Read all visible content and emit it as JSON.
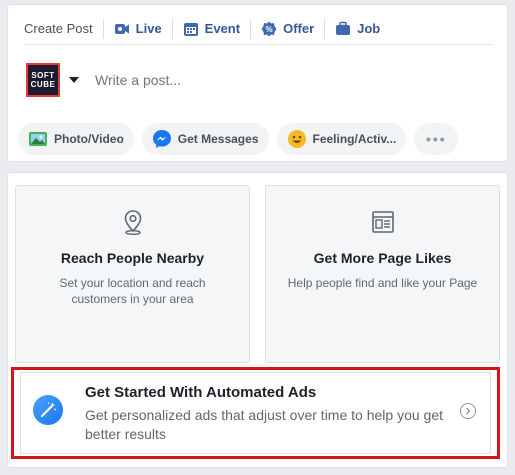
{
  "composer": {
    "tabs": [
      {
        "label": "Create Post",
        "icon": "none"
      },
      {
        "label": "Live",
        "icon": "live-video-icon"
      },
      {
        "label": "Event",
        "icon": "calendar-icon"
      },
      {
        "label": "Offer",
        "icon": "offer-tag-icon"
      },
      {
        "label": "Job",
        "icon": "briefcase-icon"
      }
    ],
    "avatar_text_line1": "SOFT",
    "avatar_text_line2": "CUBE",
    "write_placeholder": "Write a post...",
    "chips": [
      {
        "label": "Photo/Video",
        "icon": "photo-icon"
      },
      {
        "label": "Get Messages",
        "icon": "messenger-icon"
      },
      {
        "label": "Feeling/Activ...",
        "icon": "smiley-icon"
      }
    ],
    "more_label": "•••"
  },
  "promote": {
    "reach": {
      "title": "Reach People Nearby",
      "subtitle": "Set your location and reach customers in your area",
      "icon": "location-pin-icon"
    },
    "likes": {
      "title": "Get More Page Likes",
      "subtitle": "Help people find and like your Page",
      "icon": "page-icon"
    },
    "automated": {
      "title": "Get Started With Automated Ads",
      "subtitle": "Get personalized ads that adjust over time to help you get better results",
      "icon": "magic-wand-icon",
      "highlight_color": "#d4151b"
    }
  },
  "colors": {
    "link": "#365899",
    "accent": "#1877f2"
  }
}
